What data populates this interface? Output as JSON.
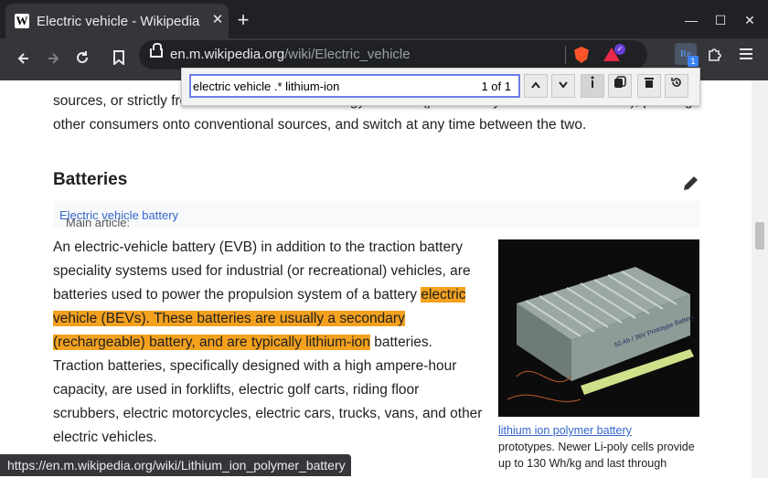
{
  "tab": {
    "favicon": "W",
    "title": "Electric vehicle - Wikipedia",
    "close": "✕"
  },
  "window": {
    "new_tab": "+",
    "minimize": "—",
    "maximize": "☐",
    "close": "✕"
  },
  "address": {
    "host": "en.m.wikipedia.org",
    "path": "/wiki/Electric_vehicle"
  },
  "extensions": {
    "re_label": "Re",
    "re_badge": "1",
    "rewards_badge": "✓"
  },
  "find": {
    "query": "electric vehicle .* lithium-ion",
    "count": "1 of 1"
  },
  "article": {
    "intro_tail": "sources, or strictly from renewable electric energy sources (presumably at an additional cost), pushing other consumers onto conventional sources, and switch at any time between the two.",
    "heading": "Batteries",
    "hatnote_prefix": "Main article: ",
    "hatnote_link": "Electric vehicle battery",
    "body_before": "An electric-vehicle battery (EVB) in addition to the traction battery speciality systems used for industrial (or recreational) vehicles, are batteries used to power the propulsion system of a battery ",
    "body_highlight": "electric vehicle (BEVs). These batteries are usually a secondary (rechargeable) battery, and are typically lithium-ion",
    "body_after": " batteries. Traction batteries, specifically designed with a high ampere-hour capacity, are used in forklifts, electric golf carts, riding floor scrubbers, electric motorcycles, electric cars, trucks, vans, and other electric vehicles.",
    "caption_link": "lithium ion polymer battery",
    "caption_text": "prototypes. Newer Li-poly cells provide up to 130 Wh/kg and last through",
    "image_label": "50 Ah / 36V Prototype Battery"
  },
  "status_url": "https://en.m.wikipedia.org/wiki/Lithium_ion_polymer_battery",
  "colors": {
    "find_highlight": "#f4a11e",
    "link": "#3366cc",
    "chrome_dark": "#202124"
  }
}
